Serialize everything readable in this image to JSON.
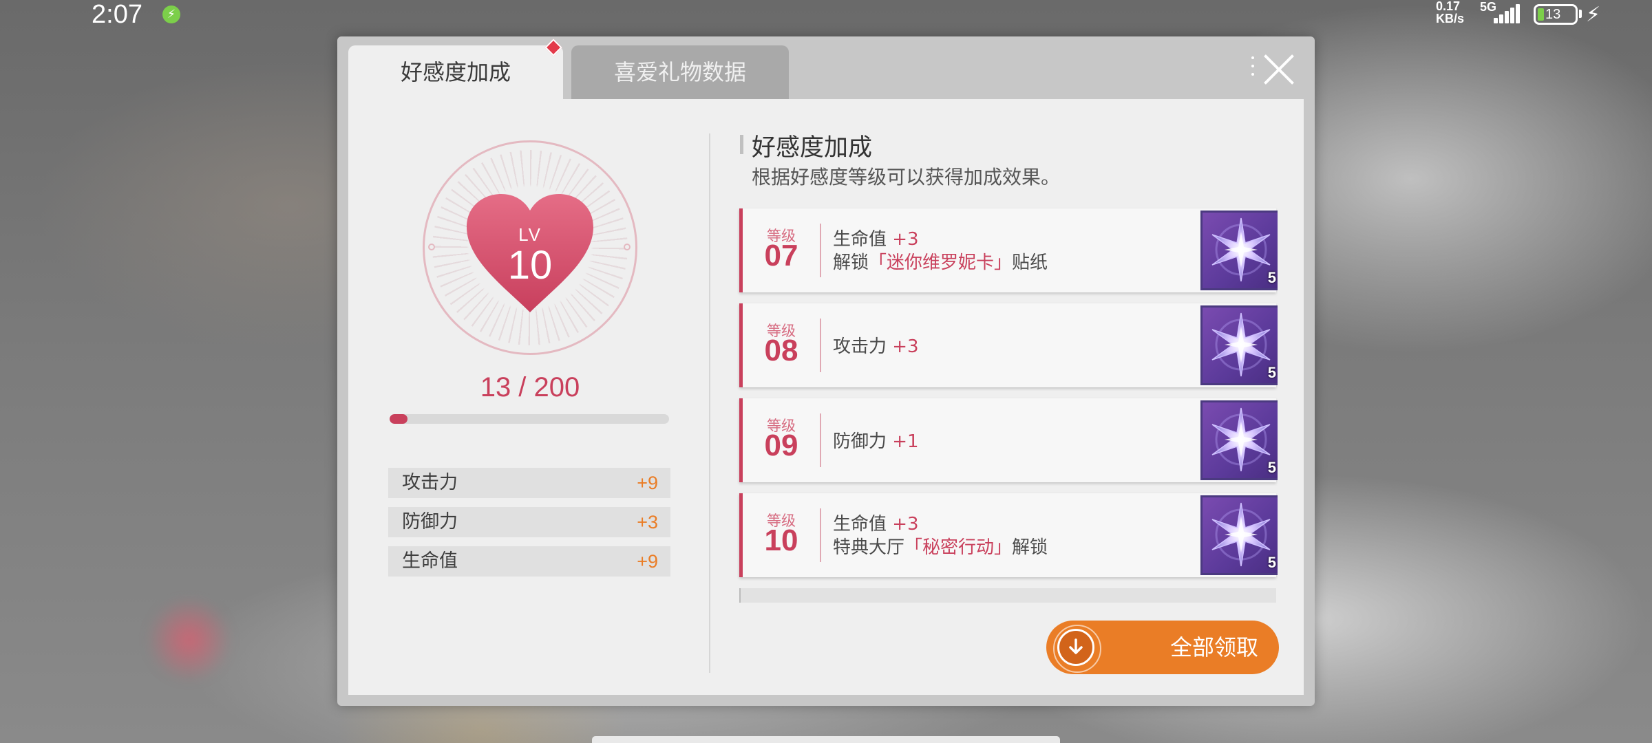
{
  "status_bar": {
    "time": "2:07",
    "net_speed_value": "0.17",
    "net_speed_unit": "KB/s",
    "network_type": "5G",
    "battery": "13"
  },
  "tabs": [
    {
      "label": "好感度加成",
      "active": true
    },
    {
      "label": "喜爱礼物数据",
      "active": false
    }
  ],
  "affinity": {
    "lv_label": "LV",
    "level": "10",
    "progress_text": "13 / 200",
    "progress_current": 13,
    "progress_max": 200
  },
  "stats": [
    {
      "name": "攻击力",
      "value": "+9"
    },
    {
      "name": "防御力",
      "value": "+3"
    },
    {
      "name": "生命值",
      "value": "+9"
    }
  ],
  "section": {
    "title": "好感度加成",
    "description": "根据好感度等级可以获得加成效果。"
  },
  "rewards": [
    {
      "level_label": "等级",
      "level": "07",
      "line1": {
        "prefix": "生命值 ",
        "highlight": "+3",
        "suffix": ""
      },
      "line2": {
        "prefix": "解锁",
        "highlight": "「迷你维罗妮卡」",
        "suffix": "贴纸"
      },
      "item_count": "5"
    },
    {
      "level_label": "等级",
      "level": "08",
      "line1": {
        "prefix": "攻击力 ",
        "highlight": "+3",
        "suffix": ""
      },
      "item_count": "5"
    },
    {
      "level_label": "等级",
      "level": "09",
      "line1": {
        "prefix": "防御力 ",
        "highlight": "+1",
        "suffix": ""
      },
      "item_count": "5"
    },
    {
      "level_label": "等级",
      "level": "10",
      "line1": {
        "prefix": "生命值 ",
        "highlight": "+3",
        "suffix": ""
      },
      "line2": {
        "prefix": "特典大厅",
        "highlight": "「秘密行动」",
        "suffix": "解锁"
      },
      "item_count": "5"
    }
  ],
  "claim_button": {
    "label": "全部领取",
    "icon": "download-circle-icon"
  },
  "colors": {
    "accent": "#c9405c",
    "button": "#ea7d26",
    "stat_value": "#ea7d26"
  }
}
